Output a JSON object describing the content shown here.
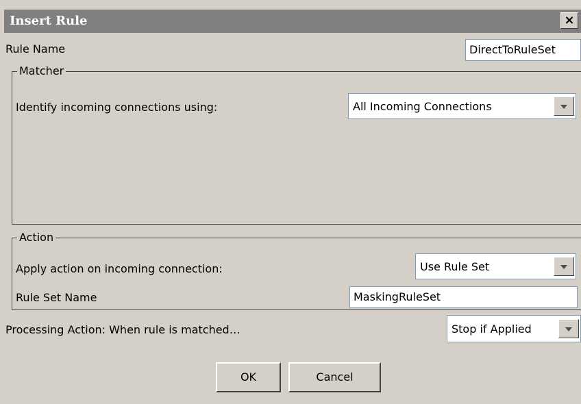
{
  "dialog": {
    "title": "Insert Rule",
    "close_label": "✕"
  },
  "rule_name": {
    "label": "Rule Name",
    "value": "DirectToRuleSet"
  },
  "matcher": {
    "legend": "Matcher",
    "identify_label": "Identify incoming connections using:",
    "identify_value": "All Incoming Connections"
  },
  "action": {
    "legend": "Action",
    "apply_label": "Apply action on incoming connection:",
    "apply_value": "Use Rule Set",
    "rule_set_label": "Rule Set Name",
    "rule_set_value": "MaskingRuleSet"
  },
  "processing": {
    "label": "Processing Action: When rule is matched…",
    "value": "Stop if Applied"
  },
  "buttons": {
    "ok": "OK",
    "cancel": "Cancel"
  },
  "icons": {
    "close": "close-icon",
    "dropdown": "chevron-down-icon"
  }
}
